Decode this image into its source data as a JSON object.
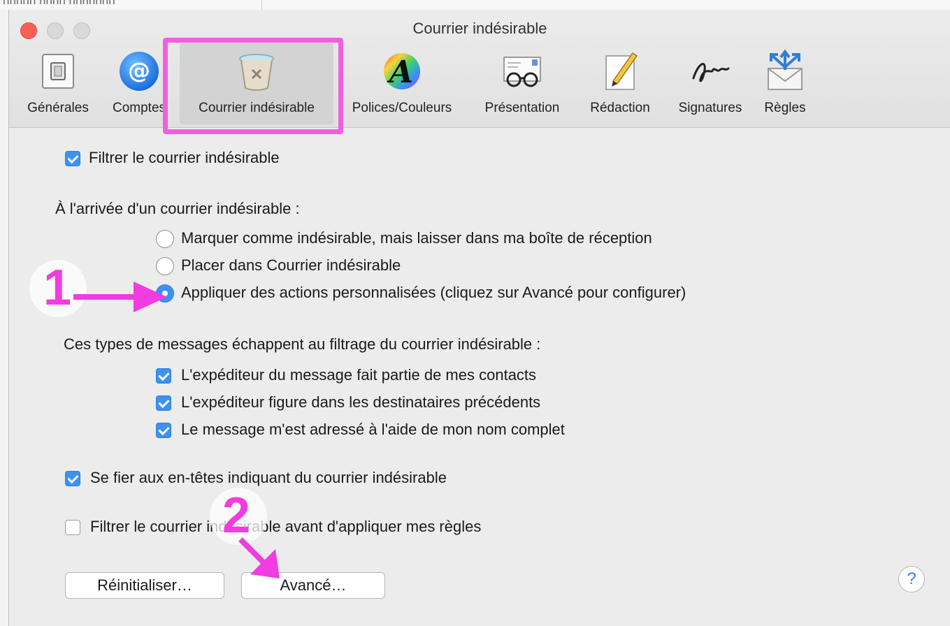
{
  "background_text": "nnnnn nnnn nnnnnnn",
  "window": {
    "title": "Courrier indésirable"
  },
  "toolbar": [
    {
      "label": "Générales",
      "icon": "switch-icon",
      "selected": false
    },
    {
      "label": "Comptes",
      "icon": "at-sign-icon",
      "selected": false
    },
    {
      "label": "Courrier indésirable",
      "icon": "junk-trash-icon",
      "selected": true
    },
    {
      "label": "Polices/Couleurs",
      "icon": "font-color-icon",
      "selected": false
    },
    {
      "label": "Présentation",
      "icon": "glasses-letter-icon",
      "selected": false
    },
    {
      "label": "Rédaction",
      "icon": "pencil-paper-icon",
      "selected": false
    },
    {
      "label": "Signatures",
      "icon": "signature-icon",
      "selected": false
    },
    {
      "label": "Règles",
      "icon": "envelope-arrows-icon",
      "selected": false
    }
  ],
  "options": {
    "filter_junk": {
      "label": "Filtrer le courrier indésirable",
      "checked": true
    },
    "arrival_heading": "À l'arrivée d'un courrier indésirable :",
    "arrival_choices": [
      {
        "label": "Marquer comme indésirable, mais laisser dans ma boîte de réception",
        "selected": false
      },
      {
        "label": "Placer dans Courrier indésirable",
        "selected": false
      },
      {
        "label": "Appliquer des actions personnalisées (cliquez sur Avancé pour configurer)",
        "selected": true
      }
    ],
    "exempt_heading": "Ces types de messages échappent au filtrage du courrier indésirable :",
    "exempt_choices": [
      {
        "label": "L'expéditeur du message fait partie de mes contacts",
        "checked": true
      },
      {
        "label": "L'expéditeur figure dans les destinataires précédents",
        "checked": true
      },
      {
        "label": "Le message m'est adressé à l'aide de mon nom complet",
        "checked": true
      }
    ],
    "trust_headers": {
      "label": "Se fier aux en-têtes indiquant du courrier indésirable",
      "checked": true
    },
    "filter_before_rules": {
      "label": "Filtrer le courrier indésirable avant d'appliquer mes règles",
      "checked": false
    }
  },
  "buttons": {
    "reset": "Réinitialiser…",
    "advanced": "Avancé…",
    "help": "?"
  },
  "annotations": {
    "step1": "1",
    "step2": "2",
    "color": "#f03ce0"
  },
  "colors": {
    "accent": "#3b92f0",
    "highlight": "#f25ee0",
    "close": "#fc5f57"
  }
}
